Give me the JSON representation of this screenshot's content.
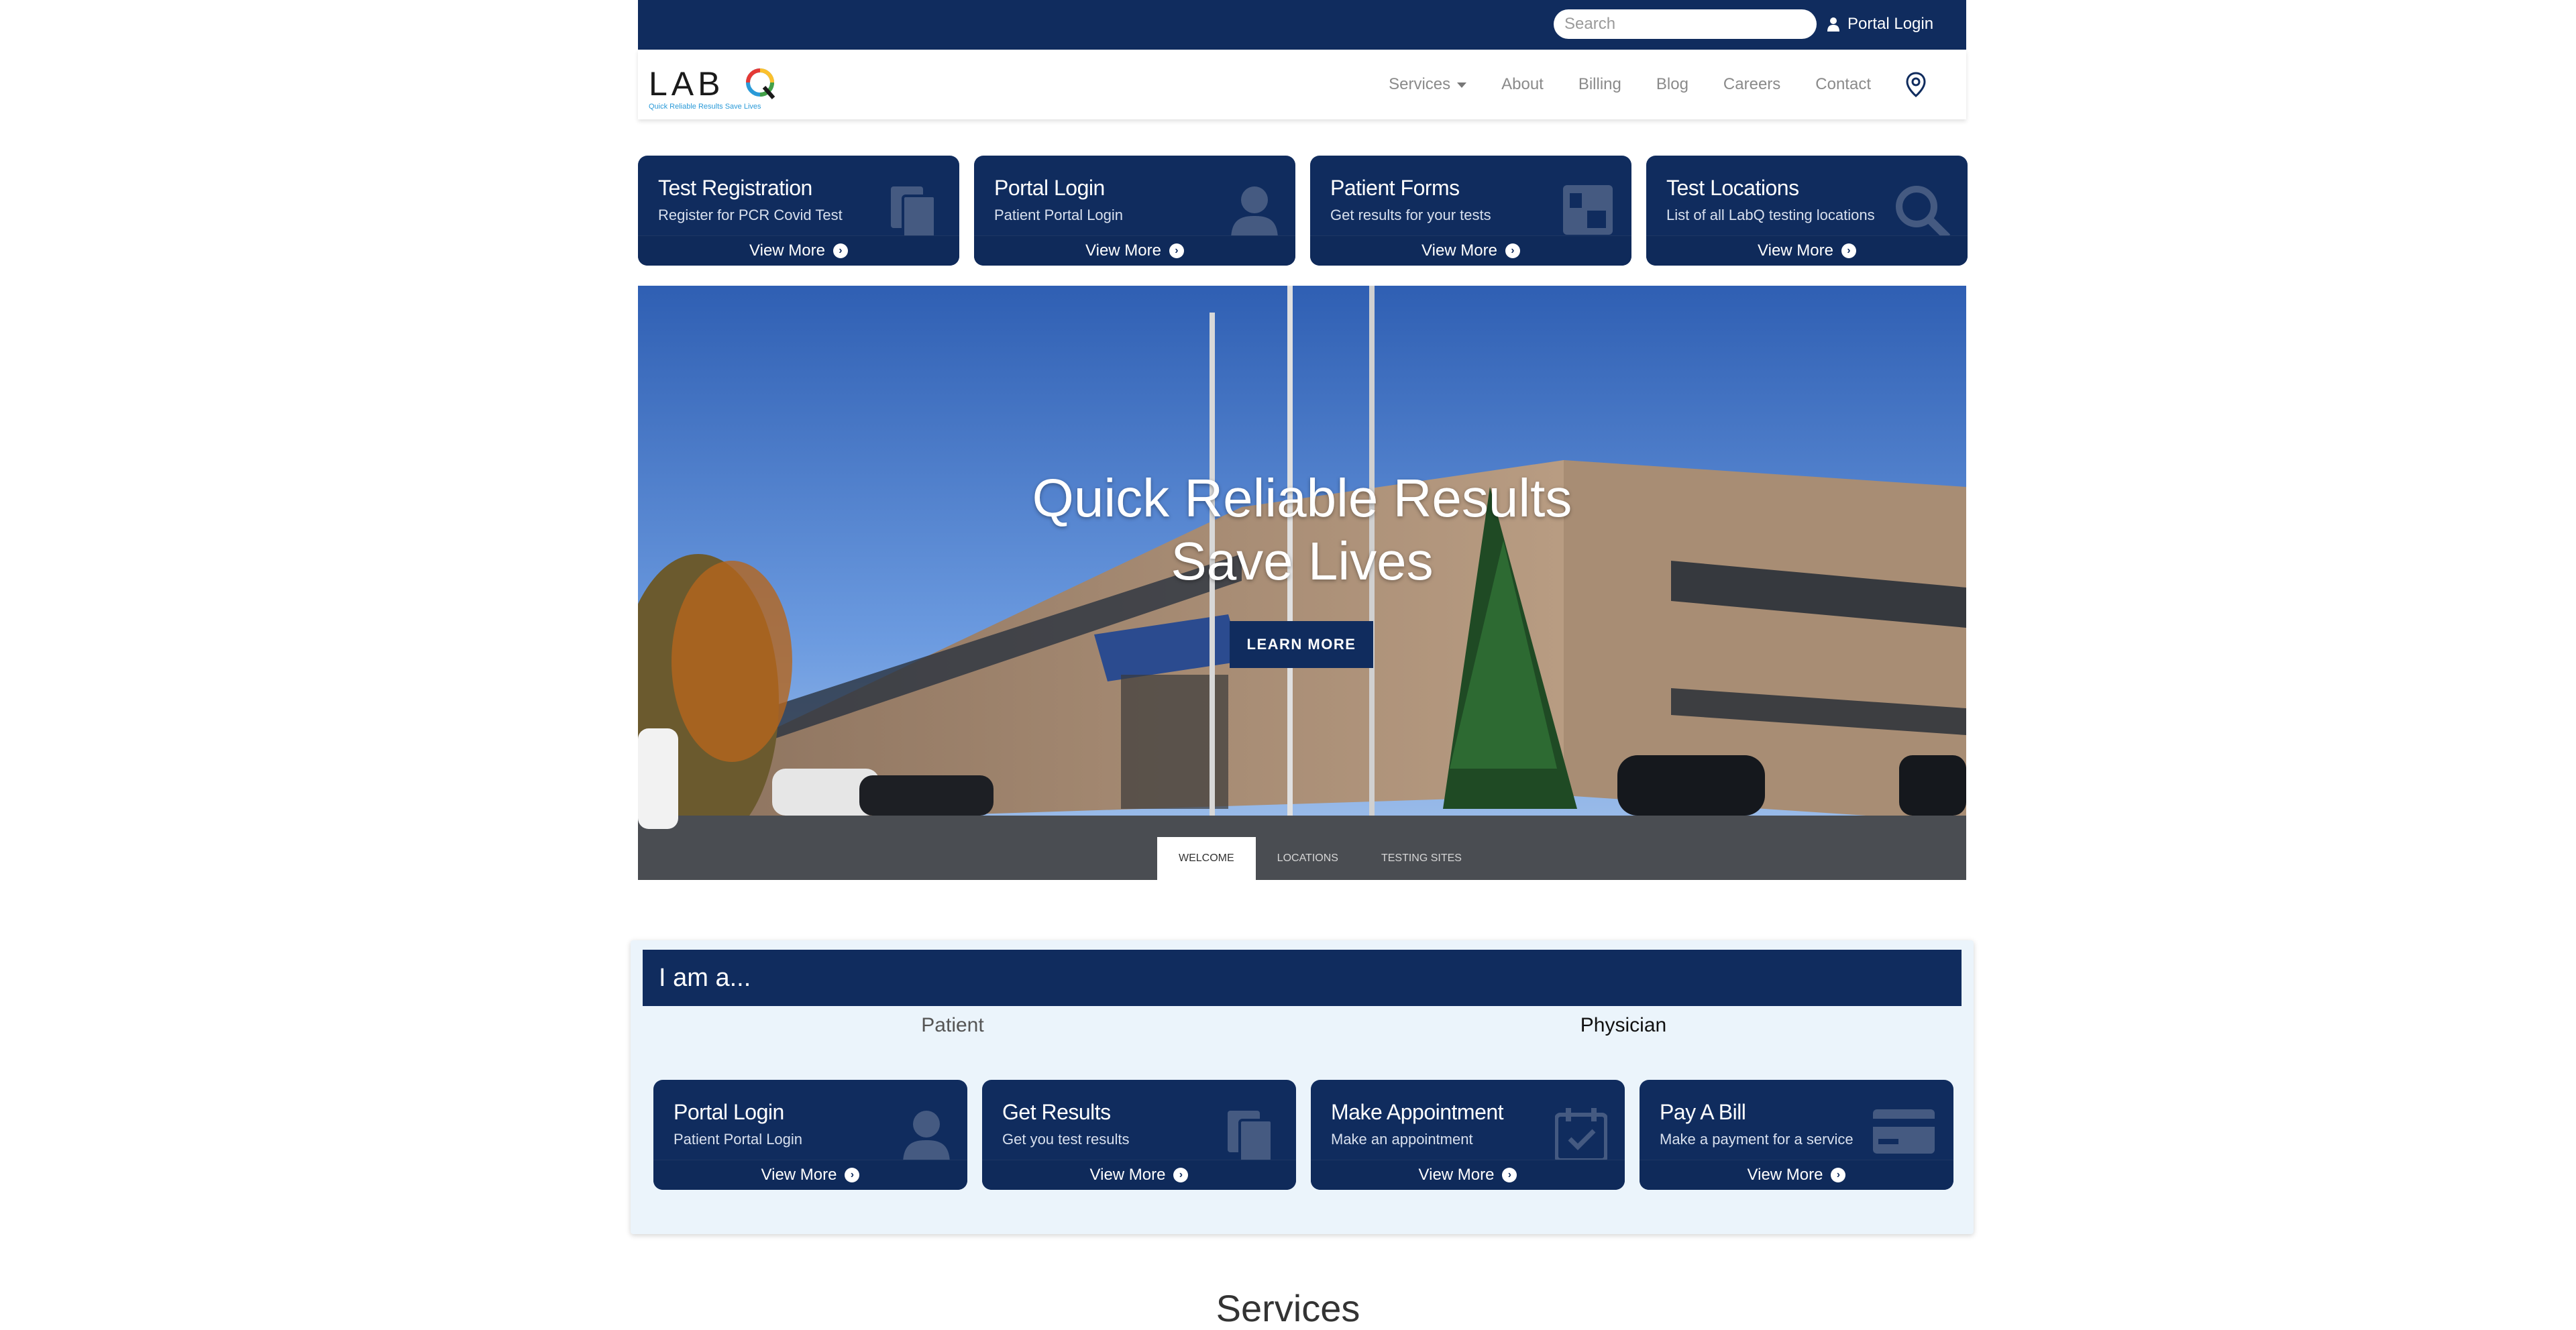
{
  "topbar": {
    "search_placeholder": "Search",
    "portal_login": "Portal Login"
  },
  "logo": {
    "name": "LabQ",
    "tagline": "Quick Reliable Results Save Lives"
  },
  "nav": {
    "items": [
      "Services",
      "About",
      "Billing",
      "Blog",
      "Careers",
      "Contact"
    ]
  },
  "top_cards": [
    {
      "title": "Test Registration",
      "subtitle": "Register for PCR Covid Test",
      "more": "View More",
      "icon": "documents-icon"
    },
    {
      "title": "Portal Login",
      "subtitle": "Patient Portal Login",
      "more": "View More",
      "icon": "user-icon"
    },
    {
      "title": "Patient Forms",
      "subtitle": "Get results for your tests",
      "more": "View More",
      "icon": "form-icon"
    },
    {
      "title": "Test Locations",
      "subtitle": "List of all LabQ testing locations",
      "more": "View More",
      "icon": "search-icon"
    }
  ],
  "hero": {
    "title_line1": "Quick Reliable Results",
    "title_line2": "Save Lives",
    "button": "LEARN MORE",
    "tabs": [
      "WELCOME",
      "LOCATIONS",
      "TESTING SITES"
    ],
    "active_tab": 0
  },
  "iam": {
    "heading": "I am a...",
    "tabs": [
      "Patient",
      "Physician"
    ],
    "cards": [
      {
        "title": "Portal Login",
        "subtitle": "Patient Portal Login",
        "more": "View More",
        "icon": "user-icon"
      },
      {
        "title": "Get Results",
        "subtitle": "Get you test results",
        "more": "View More",
        "icon": "documents-icon"
      },
      {
        "title": "Make Appointment",
        "subtitle": "Make an appointment",
        "more": "View More",
        "icon": "calendar-icon"
      },
      {
        "title": "Pay A Bill",
        "subtitle": "Make a payment for a service",
        "more": "View More",
        "icon": "credit-card-icon"
      }
    ]
  },
  "services_heading": "Services",
  "colors": {
    "brand_navy": "#102c5e",
    "light_section": "#ebf4fb"
  }
}
